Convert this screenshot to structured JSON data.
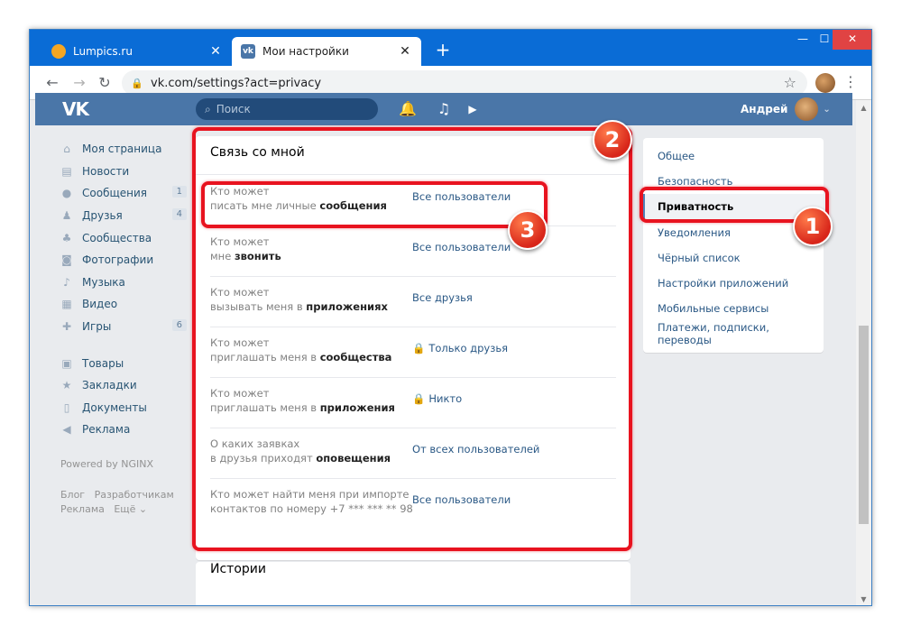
{
  "browser": {
    "tabs": [
      {
        "title": "Lumpics.ru",
        "favicon": "lumpics-favicon",
        "active": false
      },
      {
        "title": "Мои настройки",
        "favicon": "vk-favicon",
        "active": true
      }
    ],
    "new_tab": "+",
    "url": "vk.com/settings?act=privacy",
    "window_controls": {
      "minimize": "—",
      "maximize": "☐",
      "close": "✕"
    },
    "nav": {
      "back": "←",
      "forward": "→",
      "reload": "↻"
    }
  },
  "vk": {
    "logo": "VK",
    "search_placeholder": "Поиск",
    "user_name": "Андрей",
    "colors": {
      "header": "#4a76a8",
      "link": "#2a5885",
      "annotation": "#e8131f"
    }
  },
  "left_menu": {
    "items": [
      {
        "label": "Моя страница",
        "icon": "home-icon",
        "count": ""
      },
      {
        "label": "Новости",
        "icon": "news-icon",
        "count": ""
      },
      {
        "label": "Сообщения",
        "icon": "messages-icon",
        "count": "1"
      },
      {
        "label": "Друзья",
        "icon": "friends-icon",
        "count": "4"
      },
      {
        "label": "Сообщества",
        "icon": "groups-icon",
        "count": ""
      },
      {
        "label": "Фотографии",
        "icon": "photos-icon",
        "count": ""
      },
      {
        "label": "Музыка",
        "icon": "music-icon",
        "count": ""
      },
      {
        "label": "Видео",
        "icon": "video-icon",
        "count": ""
      },
      {
        "label": "Игры",
        "icon": "games-icon",
        "count": "6"
      },
      {
        "label": "Товары",
        "icon": "goods-icon",
        "count": ""
      },
      {
        "label": "Закладки",
        "icon": "bookmarks-icon",
        "count": ""
      },
      {
        "label": "Документы",
        "icon": "documents-icon",
        "count": ""
      },
      {
        "label": "Реклама",
        "icon": "ads-icon",
        "count": ""
      }
    ],
    "powered": "Powered by NGINX",
    "footer": {
      "blog": "Блог",
      "dev": "Разработчикам",
      "ads": "Реклама",
      "more": "Ещё ⌄"
    }
  },
  "section": {
    "title": "Связь со мной",
    "rows": [
      {
        "line1": "Кто может",
        "line2_plain": "писать мне личные ",
        "line2_bold": "сообщения",
        "value": "Все пользователи",
        "locked": false
      },
      {
        "line1": "Кто может",
        "line2_plain": "мне ",
        "line2_bold": "звонить",
        "value": "Все пользователи",
        "locked": false
      },
      {
        "line1": "Кто может",
        "line2_plain": "вызывать меня в ",
        "line2_bold": "приложениях",
        "value": "Все друзья",
        "locked": false
      },
      {
        "line1": "Кто может",
        "line2_plain": "приглашать меня в ",
        "line2_bold": "сообщества",
        "value": "Только друзья",
        "locked": true
      },
      {
        "line1": "Кто может",
        "line2_plain": "приглашать меня в ",
        "line2_bold": "приложения",
        "value": "Никто",
        "locked": true
      },
      {
        "line1": "О каких заявках",
        "line2_plain": "в друзья приходят ",
        "line2_bold": "оповещения",
        "value": "От всех пользователей",
        "locked": false
      },
      {
        "line1": "Кто может найти меня при импорте",
        "line2_plain": "контактов по номеру +7 *** *** ** 98",
        "line2_bold": "",
        "value": "Все пользователи",
        "locked": false
      }
    ],
    "next_title": "Истории"
  },
  "right_menu": {
    "items": [
      {
        "label": "Общее",
        "selected": false
      },
      {
        "label": "Безопасность",
        "selected": false
      },
      {
        "label": "Приватность",
        "selected": true
      },
      {
        "label": "Уведомления",
        "selected": false
      },
      {
        "label": "Чёрный список",
        "selected": false
      },
      {
        "label": "Настройки приложений",
        "selected": false
      },
      {
        "label": "Мобильные сервисы",
        "selected": false
      },
      {
        "label": "Платежи, подписки, переводы",
        "selected": false
      }
    ]
  },
  "annotations": {
    "step1": "1",
    "step2": "2",
    "step3": "3"
  }
}
